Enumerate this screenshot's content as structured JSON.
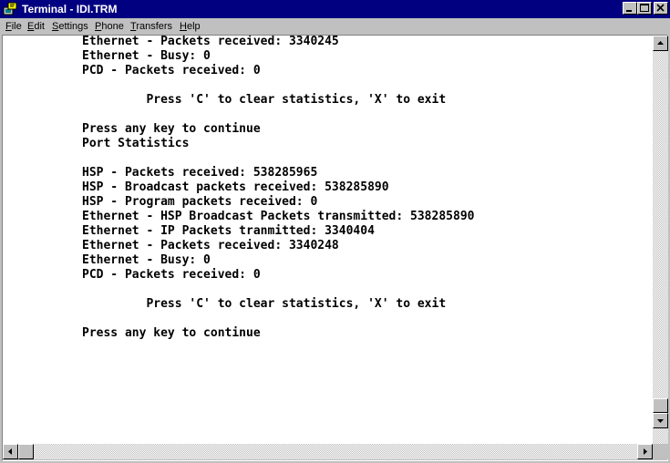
{
  "window": {
    "title": "Terminal - IDI.TRM",
    "app_icon": "terminal-icon",
    "buttons": [
      "minimize-icon",
      "maximize-icon",
      "close-icon"
    ]
  },
  "menu": {
    "items": [
      "File",
      "Edit",
      "Settings",
      "Phone",
      "Transfers",
      "Help"
    ],
    "mnemonics": [
      "F",
      "E",
      "S",
      "P",
      "T",
      "H"
    ]
  },
  "terminal": {
    "lines": [
      "Ethernet - Packets received: 3340245",
      "Ethernet - Busy: 0",
      "PCD - Packets received: 0",
      "",
      "         Press 'C' to clear statistics, 'X' to exit",
      "",
      "Press any key to continue",
      "Port Statistics",
      "",
      "HSP - Packets received: 538285965",
      "HSP - Broadcast packets received: 538285890",
      "HSP - Program packets received: 0",
      "Ethernet - HSP Broadcast Packets transmitted: 538285890",
      "Ethernet - IP Packets tranmitted: 3340404",
      "Ethernet - Packets received: 3340248",
      "Ethernet - Busy: 0",
      "PCD - Packets received: 0",
      "",
      "         Press 'C' to clear statistics, 'X' to exit",
      "",
      "Press any key to continue"
    ]
  },
  "colors": {
    "titlebar": "#000080",
    "face": "#c0c0c0",
    "terminal_bg": "#ffffff",
    "terminal_fg": "#000000"
  }
}
